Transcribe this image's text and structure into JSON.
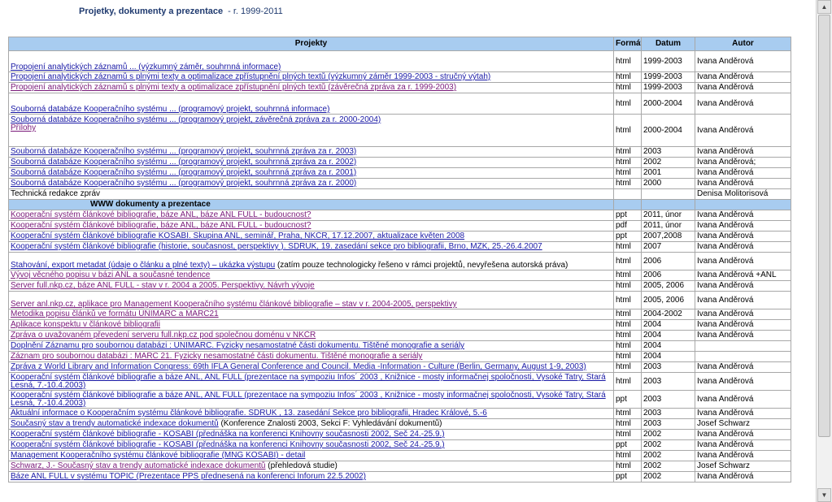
{
  "title": {
    "main": "Projetky, dokumenty a prezentace",
    "sub": "- r. 1999-2011"
  },
  "headers": {
    "projects": "Projekty",
    "format": "Formát",
    "date": "Datum",
    "author": "Autor"
  },
  "section_www": "WWW  dokumenty a prezentace",
  "rows": [
    {
      "t": "Propojení analytických záznamů ... (výzkumný záměr, souhrnná informace)",
      "f": "html",
      "d": "1999-2003",
      "a": "Ivana Anděrová"
    },
    {
      "t": "Propojení analytických záznamů s plnými texty a optimalizace zpřístupnění plných textů (výzkumný záměr 1999-2003 - stručný výtah)",
      "f": "html",
      "d": "1999-2003",
      "a": "Ivana Anděrová"
    },
    {
      "t": "Propojení analytických záznamů s plnými texty a optimalizace zpřístupnění plných textů (závěrečná zpráva za r. 1999-2003)",
      "f": "html",
      "d": "1999-2003",
      "a": "Ivana Anděrová"
    },
    {
      "t": "Souborná databáze Kooperačního systému ... (programový projekt, souhrnná informace)",
      "f": "html",
      "d": "2000-2004",
      "a": "Ivana Anděrová"
    },
    {
      "t": "Souborná databáze Kooperačního systému ... (programový projekt, závěrečná zpráva za r. 2000-2004)",
      "t2": "Přílohy",
      "f": "html",
      "d": "2000-2004",
      "a": "Ivana Anděrová"
    },
    {
      "t": "Souborná databáze Kooperačního systému ... (programový projekt, souhrnná zpráva za r. 2003)",
      "f": "html",
      "d": "2003",
      "a": "Ivana Anděrová"
    },
    {
      "t": "Souborná databáze Kooperačního systému ... (programový projekt, souhrnná zpráva za r. 2002)",
      "f": "html",
      "d": "2002",
      "a": "Ivana Anděrová;"
    },
    {
      "t": "Souborná databáze Kooperačního systému ... (programový projekt, souhrnná zpráva za r. 2001)",
      "f": "html",
      "d": "2001",
      "a": "Ivana Anděrová"
    },
    {
      "t": "Souborná databáze Kooperačního systému ... (programový projekt, souhrnná zpráva za r. 2000)",
      "f": "html",
      "d": "2000",
      "a": "Ivana Anděrová"
    },
    {
      "t": "Technická redakce zpráv",
      "f": "",
      "d": "",
      "a": "Denisa Molitorisová"
    }
  ],
  "www_rows": [
    {
      "t": "Kooperační systém článkové bibliografie, báze ANL, báze ANL FULL - budoucnost?",
      "f": "ppt",
      "d": "2011, únor",
      "a": "Ivana Anděrová"
    },
    {
      "t": "Kooperační systém článkové bibliografie, báze ANL, báze ANL FULL - budoucnost?",
      "f": "pdf",
      "d": "2011, únor",
      "a": "Ivana Anděrová"
    },
    {
      "t": "Kooperační systém článkové bibliografie KOSABI. Skupina ANL, seminář, Praha, NKČR, 17.12.2007, aktualizace květen 2008",
      "f": "ppt",
      "d": "2007,2008",
      "a": "Ivana Anděrová"
    },
    {
      "t": "Kooperační systém článkové bibliografie (historie, současnost, perspektivy ). SDRUK, 19. zasedání sekce pro bibliografii, Brno, MZK, 25.-26.4.2007",
      "f": "html",
      "d": "2007",
      "a": "Ivana Anděrová"
    },
    {
      "t": "Stahování, export metadat (údaje o článku a plné texty) – ukázka výstupu",
      "r": " (zatím pouze technologicky řešeno v rámci projektů, nevyřešena autorská práva)",
      "f": "html",
      "d": "2006",
      "a": "Ivana Anděrová"
    },
    {
      "t": "Vývoj věcného popisu v bázi ANL a současné tendence",
      "f": "html",
      "d": "2006",
      "a": "Ivana Anděrová +ANL"
    },
    {
      "t": "Server full.nkp.cz, báze ANL FULL  - stav v r. 2004 a 2005. Perspektivy. Návrh vývoje",
      "f": "html",
      "d": "2005, 2006",
      "a": "Ivana Anděrová"
    },
    {
      "t": "Server anl.nkp.cz, aplikace pro Management Kooperačního systému článkové bibliografie – stav v r. 2004-2005, perspektivy",
      "f": "html",
      "d": "2005, 2006",
      "a": "Ivana Anděrová"
    },
    {
      "t": "Metodika popisu článků ve formátu UNIMARC a MARC21",
      "f": "html",
      "d": "2004-2002",
      "a": "Ivana Anděrová"
    },
    {
      "t": "Aplikace konspektu v článkové bibliografii",
      "f": "html",
      "d": "2004",
      "a": "Ivana Anděrová"
    },
    {
      "t": "Zpráva o uvažovaném převedení serveru full.nkp.cz pod společnou doménu v NKČR",
      "f": "html",
      "d": "2004",
      "a": "Ivana Anděrová"
    },
    {
      "t": "Doplnění Záznamu pro soubornou databázi : UNIMARC. Fyzicky nesamostatné části dokumentu. Tištěné monografie a seriály",
      "f": "html",
      "d": "2004",
      "a": ""
    },
    {
      "t": "Záznam pro soubornou databázi : MARC 21. Fyzicky nesamostatné části dokumentu. Tištěné monografie a seriály",
      "f": "html",
      "d": "2004",
      "a": ""
    },
    {
      "t": "Zpráva z World Library and Information Congress: 69th IFLA General Conference and Council. Media -Information - Culture (Berlin, Germany, August 1-9, 2003)",
      "f": "html",
      "d": "2003",
      "a": "Ivana Anděrová"
    },
    {
      "t": "Kooperační systém článkové bibliografie a báze ANL, ANL FULL (prezentace na sympoziu Infos´ 2003 , Knižnice - mosty informačnej spoločnosti, Vysoké Tatry, Stará Lesná, 7.-10.4.2003)",
      "f": "html",
      "d": "2003",
      "a": "Ivana Anděrová"
    },
    {
      "t": "Kooperační systém článkové bibliografie a báze ANL, ANL FULL (prezentace na sympoziu Infos´ 2003 , Knižnice - mosty informačnej spoločnosti, Vysoké Tatry, Stará Lesná, 7.-10.4.2003)",
      "f": "ppt",
      "d": "2003",
      "a": "Ivana Anděrová"
    },
    {
      "t": "Aktuální informace o Kooperačním systému článkové bibliografie. SDRUK , 13. zasedání Sekce pro bibliografii, Hradec Králové, 5.-6",
      "f": "html",
      "d": "2003",
      "a": "Ivana Anděrová"
    },
    {
      "t": "Současný stav a trendy automatické indexace dokumentů",
      "r": " (Konference Znalosti 2003, Sekci F: Vyhledávání dokumentů)",
      "f": "html",
      "d": "2003",
      "a": "Josef Schwarz"
    },
    {
      "t": "Kooperační systém článkové bibliografie - KOSABI (přednáška na konferenci Knihovny současnosti 2002, Seč 24.-25.9.)",
      "f": "html",
      "d": "2002",
      "a": "Ivana Anděrová"
    },
    {
      "t": "Kooperační systém článkové bibliografie - KOSABI (přednáška na konferenci Knihovny současnosti 2002, Seč 24.-25.9.)",
      "f": "ppt",
      "d": "2002",
      "a": "Ivana Anděrová"
    },
    {
      "t": "Management Kooperačního systému článkové bibliografie (MNG KOSABI) - detail",
      "f": "html",
      "d": "2002",
      "a": "Ivana Anděrová"
    },
    {
      "t": "Schwarz, J.- Současný stav a trendy automatické indexace dokumentů",
      "r": " (přehledová studie)",
      "f": "html",
      "d": "2002",
      "a": "Josef Schwarz"
    },
    {
      "t": "Báze ANL FULL v systému TOPIC (Prezentace PPS přednesená na konferenci Inforum 22.5.2002)",
      "f": "ppt",
      "d": "2002",
      "a": "Ivana Anděrová"
    }
  ]
}
